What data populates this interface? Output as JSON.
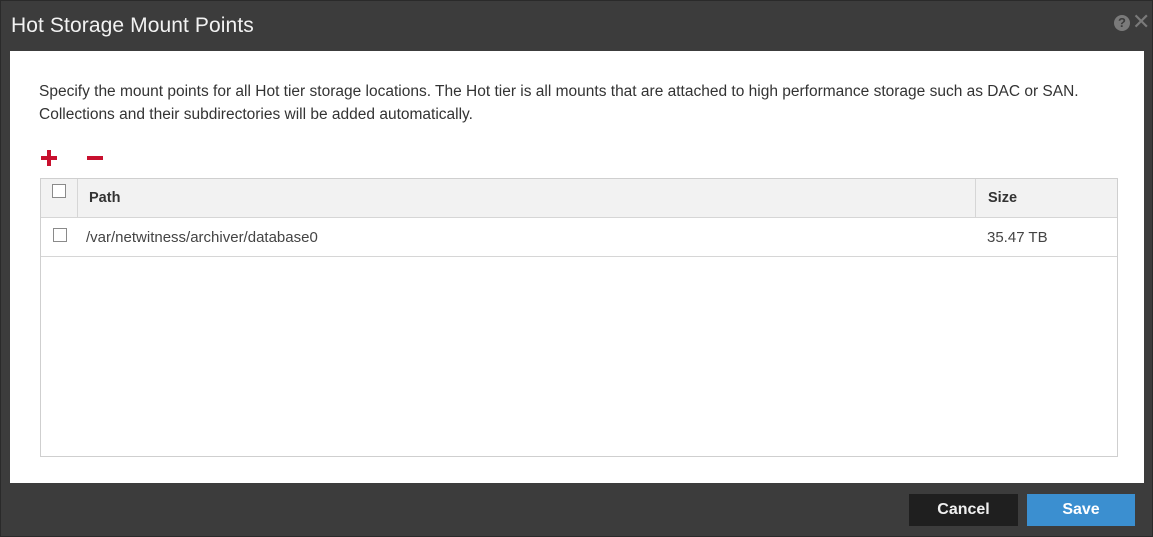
{
  "dialog": {
    "title": "Hot Storage Mount Points",
    "help_icon_glyph": "?",
    "close_icon_glyph": "✕"
  },
  "description": "Specify the mount points for all Hot tier storage locations. The Hot tier is all mounts that are attached to high performance storage such as DAC or SAN. Collections and their subdirectories will be added automatically.",
  "toolbar": {
    "add_icon": "plus-icon",
    "remove_icon": "minus-icon",
    "accent_color": "#c8102e"
  },
  "table": {
    "columns": [
      "Path",
      "Size"
    ],
    "rows": [
      {
        "path": "/var/netwitness/archiver/database0",
        "size": "35.47 TB",
        "checked": false
      }
    ]
  },
  "footer": {
    "cancel_label": "Cancel",
    "save_label": "Save",
    "save_color": "#3b8fd0"
  }
}
